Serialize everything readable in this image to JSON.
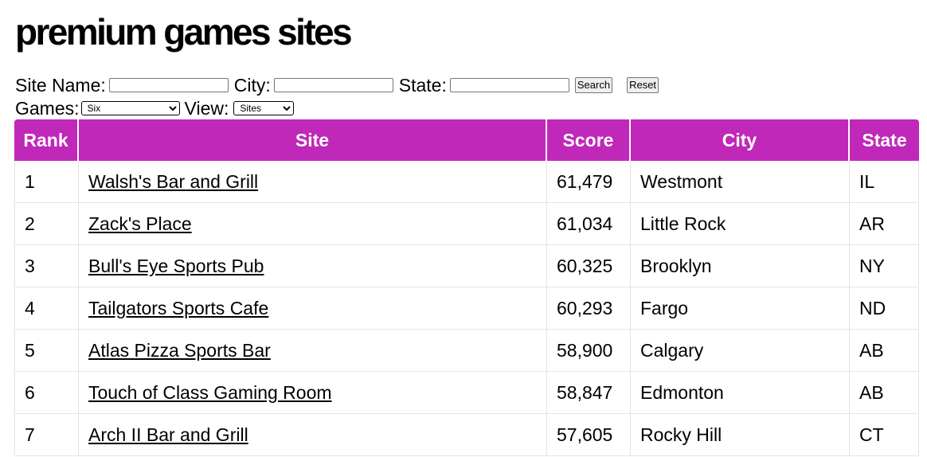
{
  "page": {
    "title": "premium games sites"
  },
  "filters": {
    "site_name_label": "Site Name:",
    "city_label": "City:",
    "state_label": "State:",
    "search_label": "Search",
    "reset_label": "Reset",
    "games_label": "Games:",
    "games_selected": "Six",
    "view_label": "View:",
    "view_selected": "Sites",
    "site_name_value": "",
    "city_value": "",
    "state_value": ""
  },
  "table": {
    "headers": [
      "Rank",
      "Site",
      "Score",
      "City",
      "State"
    ],
    "rows": [
      {
        "rank": "1",
        "site": "Walsh's Bar and Grill",
        "score": "61,479",
        "city": "Westmont",
        "state": "IL"
      },
      {
        "rank": "2",
        "site": "Zack's Place",
        "score": "61,034",
        "city": "Little Rock",
        "state": "AR"
      },
      {
        "rank": "3",
        "site": "Bull's Eye Sports Pub",
        "score": "60,325",
        "city": "Brooklyn",
        "state": "NY"
      },
      {
        "rank": "4",
        "site": "Tailgators Sports Cafe",
        "score": "60,293",
        "city": "Fargo",
        "state": "ND"
      },
      {
        "rank": "5",
        "site": "Atlas Pizza Sports Bar",
        "score": "58,900",
        "city": "Calgary",
        "state": "AB"
      },
      {
        "rank": "6",
        "site": "Touch of Class Gaming Room",
        "score": "58,847",
        "city": "Edmonton",
        "state": "AB"
      },
      {
        "rank": "7",
        "site": "Arch II Bar and Grill",
        "score": "57,605",
        "city": "Rocky Hill",
        "state": "CT"
      }
    ]
  },
  "colors": {
    "header_bg": "#c028b9",
    "header_text": "#ffffff"
  }
}
